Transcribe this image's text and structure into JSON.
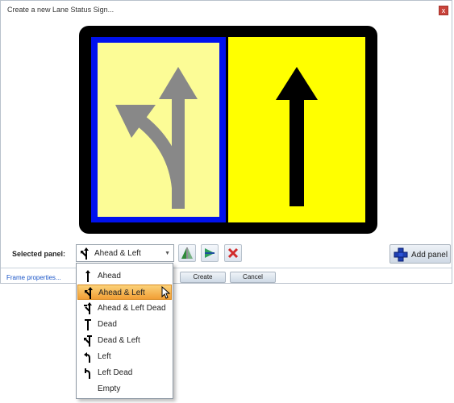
{
  "dialog": {
    "title": "Create a new Lane Status Sign...",
    "close_glyph": "x"
  },
  "colors": {
    "frame": "#000000",
    "left_border": "#0011ee",
    "left_fill": "#fcfc96",
    "right_fill": "#ffff00",
    "left_arrow": "#888888",
    "right_arrow": "#000000",
    "highlight": "#f5b552"
  },
  "preview": {
    "left_panel_icon": "ahead-and-left-arrow-icon",
    "right_panel_icon": "ahead-arrow-icon"
  },
  "selected_panel": {
    "label": "Selected panel:",
    "value": "Ahead & Left",
    "icon": "ahead-and-left-icon"
  },
  "toolbar": {
    "mirror_icon": "mirror-icon",
    "swap_icon": "swap-icon",
    "delete_icon": "delete-icon",
    "add_label": "Add panel"
  },
  "footer": {
    "frame_link": "Frame properties...",
    "create_label": "Create",
    "cancel_label": "Cancel"
  },
  "dropdown": {
    "selected_index": 1,
    "options": [
      {
        "label": "Ahead",
        "icon": "ahead-icon"
      },
      {
        "label": "Ahead & Left",
        "icon": "ahead-and-left-icon"
      },
      {
        "label": "Ahead & Left Dead",
        "icon": "ahead-and-left-dead-icon"
      },
      {
        "label": "Dead",
        "icon": "dead-icon"
      },
      {
        "label": "Dead & Left",
        "icon": "dead-and-left-icon"
      },
      {
        "label": "Left",
        "icon": "left-icon"
      },
      {
        "label": "Left Dead",
        "icon": "left-dead-icon"
      },
      {
        "label": "Empty",
        "icon": ""
      }
    ]
  }
}
